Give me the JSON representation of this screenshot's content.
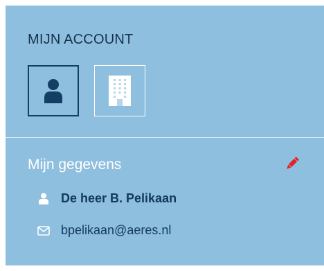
{
  "account": {
    "title": "MIJN ACCOUNT",
    "buttons": [
      {
        "icon": "user-icon",
        "state": "selected"
      },
      {
        "icon": "building-icon",
        "state": "unselected"
      }
    ]
  },
  "details": {
    "title": "Mijn gegevens",
    "edit_icon": "pencil-icon",
    "name": "De heer B. Pelikaan",
    "email": "bpelikaan@aeres.nl"
  },
  "colors": {
    "panel": "#8fbfde",
    "dark_blue": "#123f63",
    "edit_red": "#e4202b",
    "white": "#ffffff"
  }
}
